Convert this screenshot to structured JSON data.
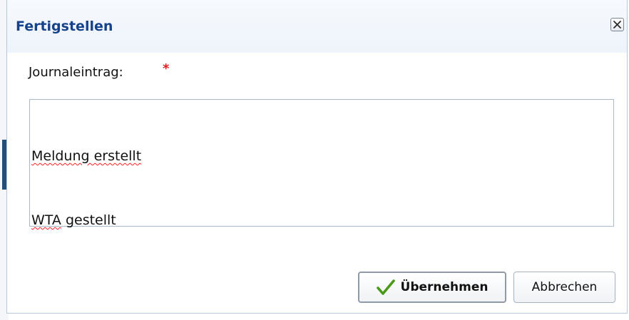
{
  "dialog": {
    "title": "Fertigstellen",
    "close_icon": "close-icon"
  },
  "form": {
    "journal_label": "Journaleintrag:",
    "required_marker": "*",
    "journal_lines": [
      "Meldung erstellt",
      "WTA gestellt"
    ]
  },
  "buttons": {
    "apply_label": "Übernehmen",
    "apply_icon": "checkmark-icon",
    "cancel_label": "Abbrechen"
  },
  "colors": {
    "title": "#15428b",
    "required": "#e02020",
    "check": "#4a9a1a"
  }
}
